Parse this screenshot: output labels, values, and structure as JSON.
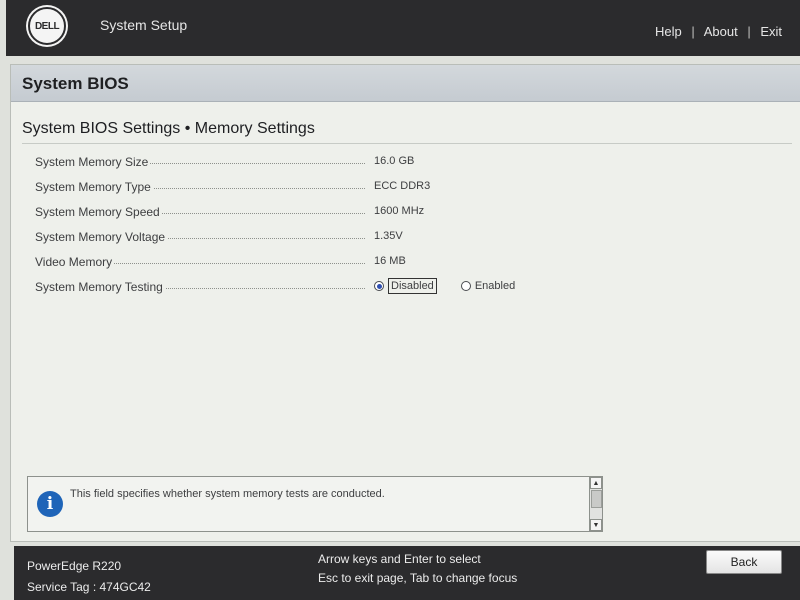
{
  "header": {
    "logo_text": "DELL",
    "app_title": "System Setup",
    "nav": [
      "Help",
      "About",
      "Exit"
    ]
  },
  "page": {
    "title": "System BIOS",
    "section_title": "System BIOS Settings • Memory Settings"
  },
  "settings": [
    {
      "label": "System Memory Size",
      "value": "16.0 GB"
    },
    {
      "label": "System Memory Type",
      "value": "ECC DDR3"
    },
    {
      "label": "System Memory Speed",
      "value": "1600 MHz"
    },
    {
      "label": "System Memory Voltage",
      "value": "1.35V"
    },
    {
      "label": "Video Memory",
      "value": "16 MB"
    },
    {
      "label": "System Memory Testing",
      "options": [
        {
          "label": "Disabled",
          "selected": true
        },
        {
          "label": "Enabled",
          "selected": false
        }
      ]
    }
  ],
  "help": {
    "icon": "info-icon",
    "text": "This field specifies whether system memory tests are conducted."
  },
  "footer": {
    "model": "PowerEdge R220",
    "service_tag": "Service Tag : 474GC42",
    "hint_line1": "Arrow keys and Enter to select",
    "hint_line2": "Esc to exit page, Tab to change focus",
    "back_label": "Back"
  },
  "colors": {
    "topbar": "#2b2b2d",
    "panel_bg": "#eef0eb",
    "radio_selected": "#2f4fb0",
    "info_icon": "#1f64b8"
  }
}
